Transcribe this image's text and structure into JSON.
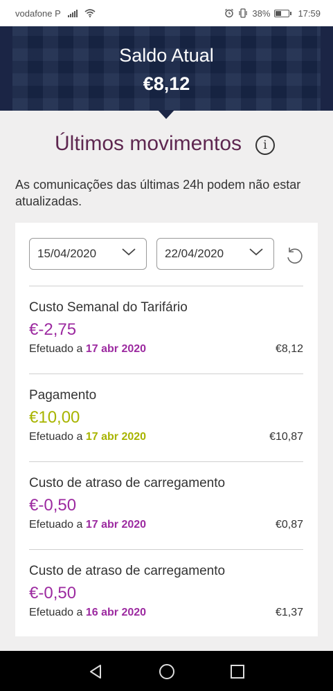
{
  "status_bar": {
    "carrier": "vodafone P",
    "battery": "38%",
    "time": "17:59"
  },
  "header": {
    "title": "Saldo Atual",
    "balance": "€8,12"
  },
  "section": {
    "title": "Últimos movimentos",
    "notice": "As comunicações das últimas 24h podem não estar atualizadas."
  },
  "filters": {
    "date_from": "15/04/2020",
    "date_to": "22/04/2020"
  },
  "transactions": [
    {
      "name": "Custo Semanal do Tarifário",
      "amount": "€-2,75",
      "label": "Efetuado a",
      "date": "17 abr 2020",
      "balance": "€8,12",
      "color": "#9c2aa0"
    },
    {
      "name": "Pagamento",
      "amount": "€10,00",
      "label": "Efetuado a",
      "date": "17 abr 2020",
      "balance": "€10,87",
      "color": "#a8b400"
    },
    {
      "name": "Custo de atraso de carregamento",
      "amount": "€-0,50",
      "label": "Efetuado a",
      "date": "17 abr 2020",
      "balance": "€0,87",
      "color": "#9c2aa0"
    },
    {
      "name": "Custo de atraso de carregamento",
      "amount": "€-0,50",
      "label": "Efetuado a",
      "date": "16 abr 2020",
      "balance": "€1,37",
      "color": "#9c2aa0"
    }
  ],
  "colors": {
    "header_bg": "#1b2545",
    "title_purple": "#5e2750",
    "negative": "#9c2aa0",
    "positive": "#a8b400"
  }
}
